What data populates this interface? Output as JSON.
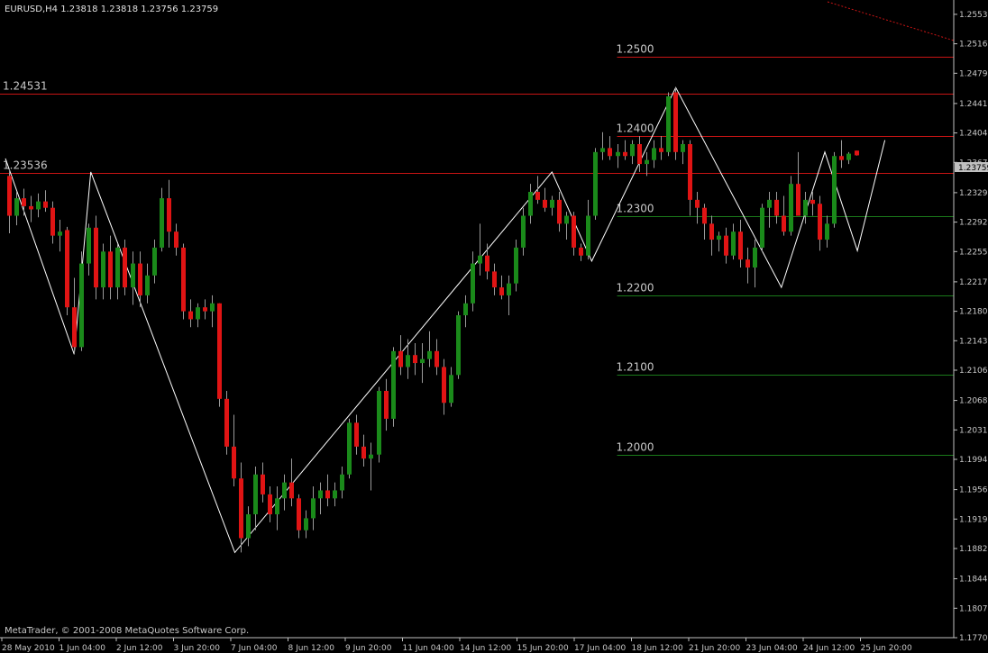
{
  "symbol_header": "EURUSD,H4  1.23818 1.23818 1.23756 1.23759",
  "copyright": "MetaTrader, © 2001-2008 MetaQuotes Software Corp.",
  "colors": {
    "background": "#000000",
    "axis": "#c0c0c0",
    "bull_candle": "#1a8a1a",
    "bear_candle": "#e01414",
    "wick": "#9a9a9a",
    "zigzag": "#ffffff",
    "resistance_line": "#c81414",
    "support_line": "#1a7a1a",
    "current_price_box": "#c0c0c0"
  },
  "chart_data": {
    "type": "candlestick",
    "timeframe": "H4",
    "symbol": "EURUSD",
    "ylim": [
      1.177,
      1.2571
    ],
    "y_ticks": [
      "1.25530",
      "1.25160",
      "1.24790",
      "1.24410",
      "1.24040",
      "1.23670",
      "1.23290",
      "1.22920",
      "1.22550",
      "1.22170",
      "1.21800",
      "1.21430",
      "1.21060",
      "1.20680",
      "1.20310",
      "1.19940",
      "1.19560",
      "1.19190",
      "1.18820",
      "1.18440",
      "1.18070",
      "1.17700"
    ],
    "x_ticks": [
      "28 May 2010",
      "1 Jun 04:00",
      "2 Jun 12:00",
      "3 Jun 20:00",
      "7 Jun 04:00",
      "8 Jun 12:00",
      "9 Jun 20:00",
      "11 Jun 04:00",
      "14 Jun 12:00",
      "15 Jun 20:00",
      "17 Jun 04:00",
      "18 Jun 12:00",
      "21 Jun 20:00",
      "23 Jun 04:00",
      "24 Jun 12:00",
      "25 Jun 20:00"
    ],
    "current_price": "1.23759",
    "levels": [
      {
        "price": 1.25,
        "label": "1.2500",
        "kind": "resistance",
        "from": 84
      },
      {
        "price": 1.24531,
        "label": "1.24531",
        "kind": "resistance",
        "from": 0
      },
      {
        "price": 1.24,
        "label": "1.2400",
        "kind": "resistance",
        "from": 84
      },
      {
        "price": 1.23536,
        "label": "1.23536",
        "kind": "resistance",
        "from": 0
      },
      {
        "price": 1.23,
        "label": "1.2300",
        "kind": "support",
        "from": 84
      },
      {
        "price": 1.22,
        "label": "1.2200",
        "kind": "support",
        "from": 84
      },
      {
        "price": 1.21,
        "label": "1.2100",
        "kind": "support",
        "from": 84
      },
      {
        "price": 1.2,
        "label": "1.2000",
        "kind": "support",
        "from": 84
      }
    ],
    "zigzag": [
      [
        -0.5,
        1.2372
      ],
      [
        9,
        1.2126
      ],
      [
        11.3,
        1.2355
      ],
      [
        31.2,
        1.1877
      ],
      [
        75,
        1.2355
      ],
      [
        80.5,
        1.2243
      ],
      [
        92.1,
        1.2461
      ],
      [
        106.7,
        1.221
      ],
      [
        112.7,
        1.238
      ],
      [
        117.2,
        1.2256
      ],
      [
        121,
        1.2395
      ]
    ],
    "candles": [
      [
        1.235,
        1.2359,
        1.2278,
        1.23
      ],
      [
        1.23,
        1.233,
        1.2288,
        1.2322
      ],
      [
        1.2322,
        1.2334,
        1.23,
        1.2312
      ],
      [
        1.2312,
        1.2325,
        1.2292,
        1.2308
      ],
      [
        1.2308,
        1.2328,
        1.2298,
        1.2318
      ],
      [
        1.2318,
        1.2332,
        1.2305,
        1.231
      ],
      [
        1.231,
        1.2318,
        1.2265,
        1.2275
      ],
      [
        1.2275,
        1.2295,
        1.2255,
        1.228
      ],
      [
        1.2282,
        1.2286,
        1.2175,
        1.2185
      ],
      [
        1.2185,
        1.2222,
        1.2126,
        1.2135
      ],
      [
        1.2135,
        1.2255,
        1.213,
        1.224
      ],
      [
        1.224,
        1.229,
        1.2225,
        1.2285
      ],
      [
        1.2285,
        1.23,
        1.2195,
        1.221
      ],
      [
        1.221,
        1.2265,
        1.2195,
        1.2255
      ],
      [
        1.2255,
        1.2275,
        1.2195,
        1.221
      ],
      [
        1.221,
        1.2265,
        1.2195,
        1.226
      ],
      [
        1.226,
        1.227,
        1.22,
        1.221
      ],
      [
        1.221,
        1.2255,
        1.2188,
        1.224
      ],
      [
        1.224,
        1.2255,
        1.2185,
        1.22
      ],
      [
        1.22,
        1.224,
        1.219,
        1.2225
      ],
      [
        1.2225,
        1.227,
        1.2215,
        1.226
      ],
      [
        1.226,
        1.2335,
        1.2255,
        1.2322
      ],
      [
        1.2322,
        1.2345,
        1.226,
        1.228
      ],
      [
        1.228,
        1.229,
        1.225,
        1.226
      ],
      [
        1.226,
        1.2265,
        1.217,
        1.218
      ],
      [
        1.218,
        1.2195,
        1.216,
        1.217
      ],
      [
        1.217,
        1.219,
        1.216,
        1.2185
      ],
      [
        1.2185,
        1.2195,
        1.217,
        1.218
      ],
      [
        1.218,
        1.22,
        1.216,
        1.219
      ],
      [
        1.219,
        1.219,
        1.206,
        1.207
      ],
      [
        1.207,
        1.208,
        1.2,
        1.201
      ],
      [
        1.201,
        1.205,
        1.196,
        1.197
      ],
      [
        1.197,
        1.199,
        1.1877,
        1.1895
      ],
      [
        1.1895,
        1.1935,
        1.1885,
        1.1925
      ],
      [
        1.1925,
        1.1985,
        1.1905,
        1.1975
      ],
      [
        1.1975,
        1.199,
        1.194,
        1.195
      ],
      [
        1.195,
        1.196,
        1.1915,
        1.1925
      ],
      [
        1.1925,
        1.196,
        1.1905,
        1.1945
      ],
      [
        1.1945,
        1.1975,
        1.193,
        1.1965
      ],
      [
        1.1965,
        1.1995,
        1.1935,
        1.1945
      ],
      [
        1.1945,
        1.195,
        1.1895,
        1.1905
      ],
      [
        1.1905,
        1.193,
        1.1895,
        1.192
      ],
      [
        1.192,
        1.196,
        1.1905,
        1.1945
      ],
      [
        1.1945,
        1.1965,
        1.1925,
        1.1955
      ],
      [
        1.1955,
        1.1975,
        1.1935,
        1.1945
      ],
      [
        1.1945,
        1.1965,
        1.1935,
        1.1955
      ],
      [
        1.1955,
        1.1985,
        1.1945,
        1.1975
      ],
      [
        1.1975,
        1.2045,
        1.197,
        1.204
      ],
      [
        1.204,
        1.205,
        1.2,
        1.201
      ],
      [
        1.201,
        1.2025,
        1.1985,
        1.1995
      ],
      [
        1.1995,
        1.2015,
        1.1955,
        1.2
      ],
      [
        1.2,
        1.2085,
        1.199,
        1.208
      ],
      [
        1.208,
        1.2095,
        1.203,
        1.2045
      ],
      [
        1.2045,
        1.2135,
        1.2035,
        1.213
      ],
      [
        1.213,
        1.215,
        1.21,
        1.211
      ],
      [
        1.211,
        1.2145,
        1.2095,
        1.2125
      ],
      [
        1.2125,
        1.214,
        1.21,
        1.2115
      ],
      [
        1.2115,
        1.214,
        1.209,
        1.212
      ],
      [
        1.212,
        1.2155,
        1.211,
        1.213
      ],
      [
        1.213,
        1.2145,
        1.21,
        1.211
      ],
      [
        1.211,
        1.212,
        1.205,
        1.2065
      ],
      [
        1.2065,
        1.211,
        1.206,
        1.21
      ],
      [
        1.21,
        1.218,
        1.2095,
        1.2175
      ],
      [
        1.2175,
        1.22,
        1.216,
        1.219
      ],
      [
        1.219,
        1.2255,
        1.218,
        1.224
      ],
      [
        1.224,
        1.229,
        1.2225,
        1.225
      ],
      [
        1.225,
        1.2265,
        1.222,
        1.223
      ],
      [
        1.223,
        1.224,
        1.22,
        1.221
      ],
      [
        1.221,
        1.2225,
        1.2195,
        1.22
      ],
      [
        1.22,
        1.2225,
        1.2175,
        1.2215
      ],
      [
        1.2215,
        1.227,
        1.2205,
        1.226
      ],
      [
        1.226,
        1.231,
        1.225,
        1.23
      ],
      [
        1.23,
        1.234,
        1.229,
        1.233
      ],
      [
        1.233,
        1.235,
        1.2315,
        1.232
      ],
      [
        1.232,
        1.2335,
        1.2305,
        1.231
      ],
      [
        1.231,
        1.2325,
        1.23,
        1.232
      ],
      [
        1.232,
        1.233,
        1.228,
        1.229
      ],
      [
        1.229,
        1.2305,
        1.227,
        1.23
      ],
      [
        1.23,
        1.2305,
        1.225,
        1.226
      ],
      [
        1.226,
        1.2265,
        1.2243,
        1.225
      ],
      [
        1.225,
        1.232,
        1.2245,
        1.23
      ],
      [
        1.23,
        1.2385,
        1.2295,
        1.238
      ],
      [
        1.238,
        1.2405,
        1.237,
        1.2385
      ],
      [
        1.2385,
        1.24,
        1.237,
        1.2375
      ],
      [
        1.2375,
        1.239,
        1.236,
        1.238
      ],
      [
        1.238,
        1.2395,
        1.237,
        1.2375
      ],
      [
        1.2375,
        1.2395,
        1.2365,
        1.239
      ],
      [
        1.239,
        1.24,
        1.2355,
        1.2365
      ],
      [
        1.2365,
        1.238,
        1.235,
        1.237
      ],
      [
        1.237,
        1.2395,
        1.236,
        1.2385
      ],
      [
        1.2385,
        1.24,
        1.237,
        1.238
      ],
      [
        1.238,
        1.2455,
        1.2375,
        1.245
      ],
      [
        1.2455,
        1.2461,
        1.237,
        1.238
      ],
      [
        1.238,
        1.2395,
        1.2365,
        1.239
      ],
      [
        1.239,
        1.2395,
        1.23,
        1.232
      ],
      [
        1.232,
        1.233,
        1.229,
        1.231
      ],
      [
        1.231,
        1.2315,
        1.227,
        1.229
      ],
      [
        1.229,
        1.23,
        1.225,
        1.227
      ],
      [
        1.227,
        1.228,
        1.2255,
        1.2275
      ],
      [
        1.2275,
        1.2285,
        1.224,
        1.225
      ],
      [
        1.225,
        1.229,
        1.2245,
        1.228
      ],
      [
        1.228,
        1.2295,
        1.2235,
        1.2245
      ],
      [
        1.2245,
        1.226,
        1.2215,
        1.2235
      ],
      [
        1.2235,
        1.227,
        1.221,
        1.226
      ],
      [
        1.226,
        1.2315,
        1.2255,
        1.231
      ],
      [
        1.231,
        1.233,
        1.2285,
        1.232
      ],
      [
        1.232,
        1.233,
        1.229,
        1.23
      ],
      [
        1.23,
        1.2325,
        1.2275,
        1.228
      ],
      [
        1.228,
        1.235,
        1.2275,
        1.234
      ],
      [
        1.234,
        1.238,
        1.232,
        1.23
      ],
      [
        1.23,
        1.233,
        1.229,
        1.232
      ],
      [
        1.232,
        1.233,
        1.23,
        1.2315
      ],
      [
        1.2315,
        1.2325,
        1.2256,
        1.227
      ],
      [
        1.227,
        1.23,
        1.226,
        1.229
      ],
      [
        1.229,
        1.238,
        1.2285,
        1.2375
      ],
      [
        1.2375,
        1.2395,
        1.236,
        1.237
      ],
      [
        1.237,
        1.238,
        1.2365,
        1.2378
      ],
      [
        1.23818,
        1.23818,
        1.23756,
        1.23759
      ]
    ]
  }
}
